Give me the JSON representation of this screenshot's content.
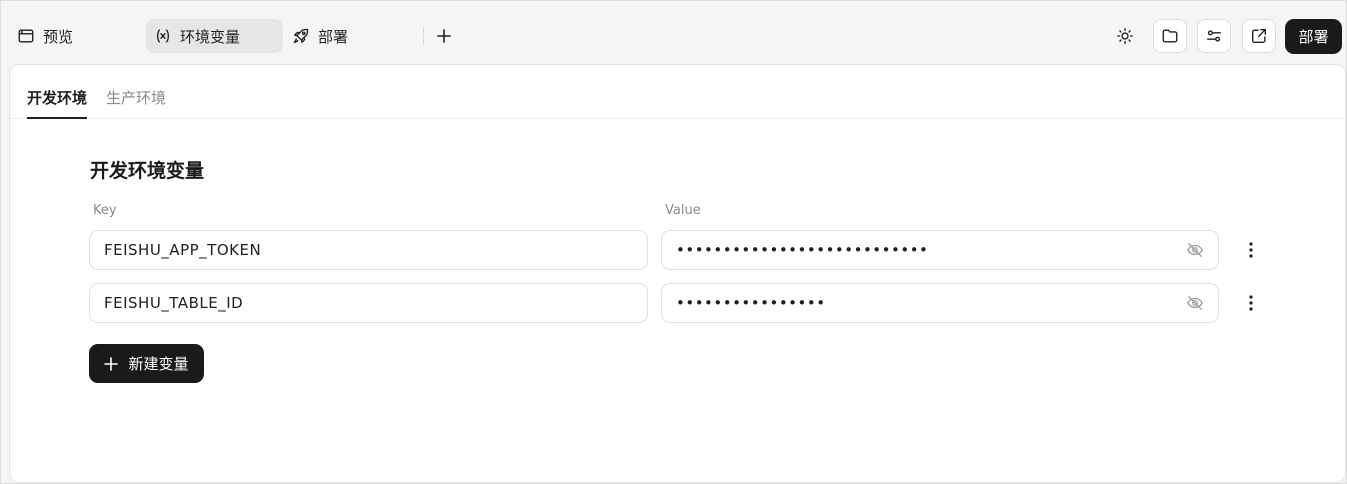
{
  "topbar": {
    "tabs": [
      {
        "label": "预览",
        "icon": "browser-window-icon"
      },
      {
        "label": "环境变量",
        "icon": "variable-icon",
        "active": true
      },
      {
        "label": "部署",
        "icon": "rocket-icon"
      }
    ],
    "tools": [
      "sun-icon",
      "folder-icon",
      "settings-sliders-icon",
      "external-link-icon"
    ],
    "deploy_label": "部署"
  },
  "env": {
    "subtabs": [
      {
        "label": "开发环境",
        "active": true
      },
      {
        "label": "生产环境",
        "active": false
      }
    ],
    "section_title": "开发环境变量",
    "key_label": "Key",
    "value_label": "Value",
    "rows": [
      {
        "key": "FEISHU_APP_TOKEN",
        "value": "•••••••••••••••••••••••••••"
      },
      {
        "key": "FEISHU_TABLE_ID",
        "value": "••••••••••••••••"
      }
    ],
    "new_var_label": "新建变量"
  },
  "colors": {
    "primary": "#1a1a1a",
    "active_tab_bg": "#e6e6e6",
    "muted_text": "#8a8a8a"
  }
}
